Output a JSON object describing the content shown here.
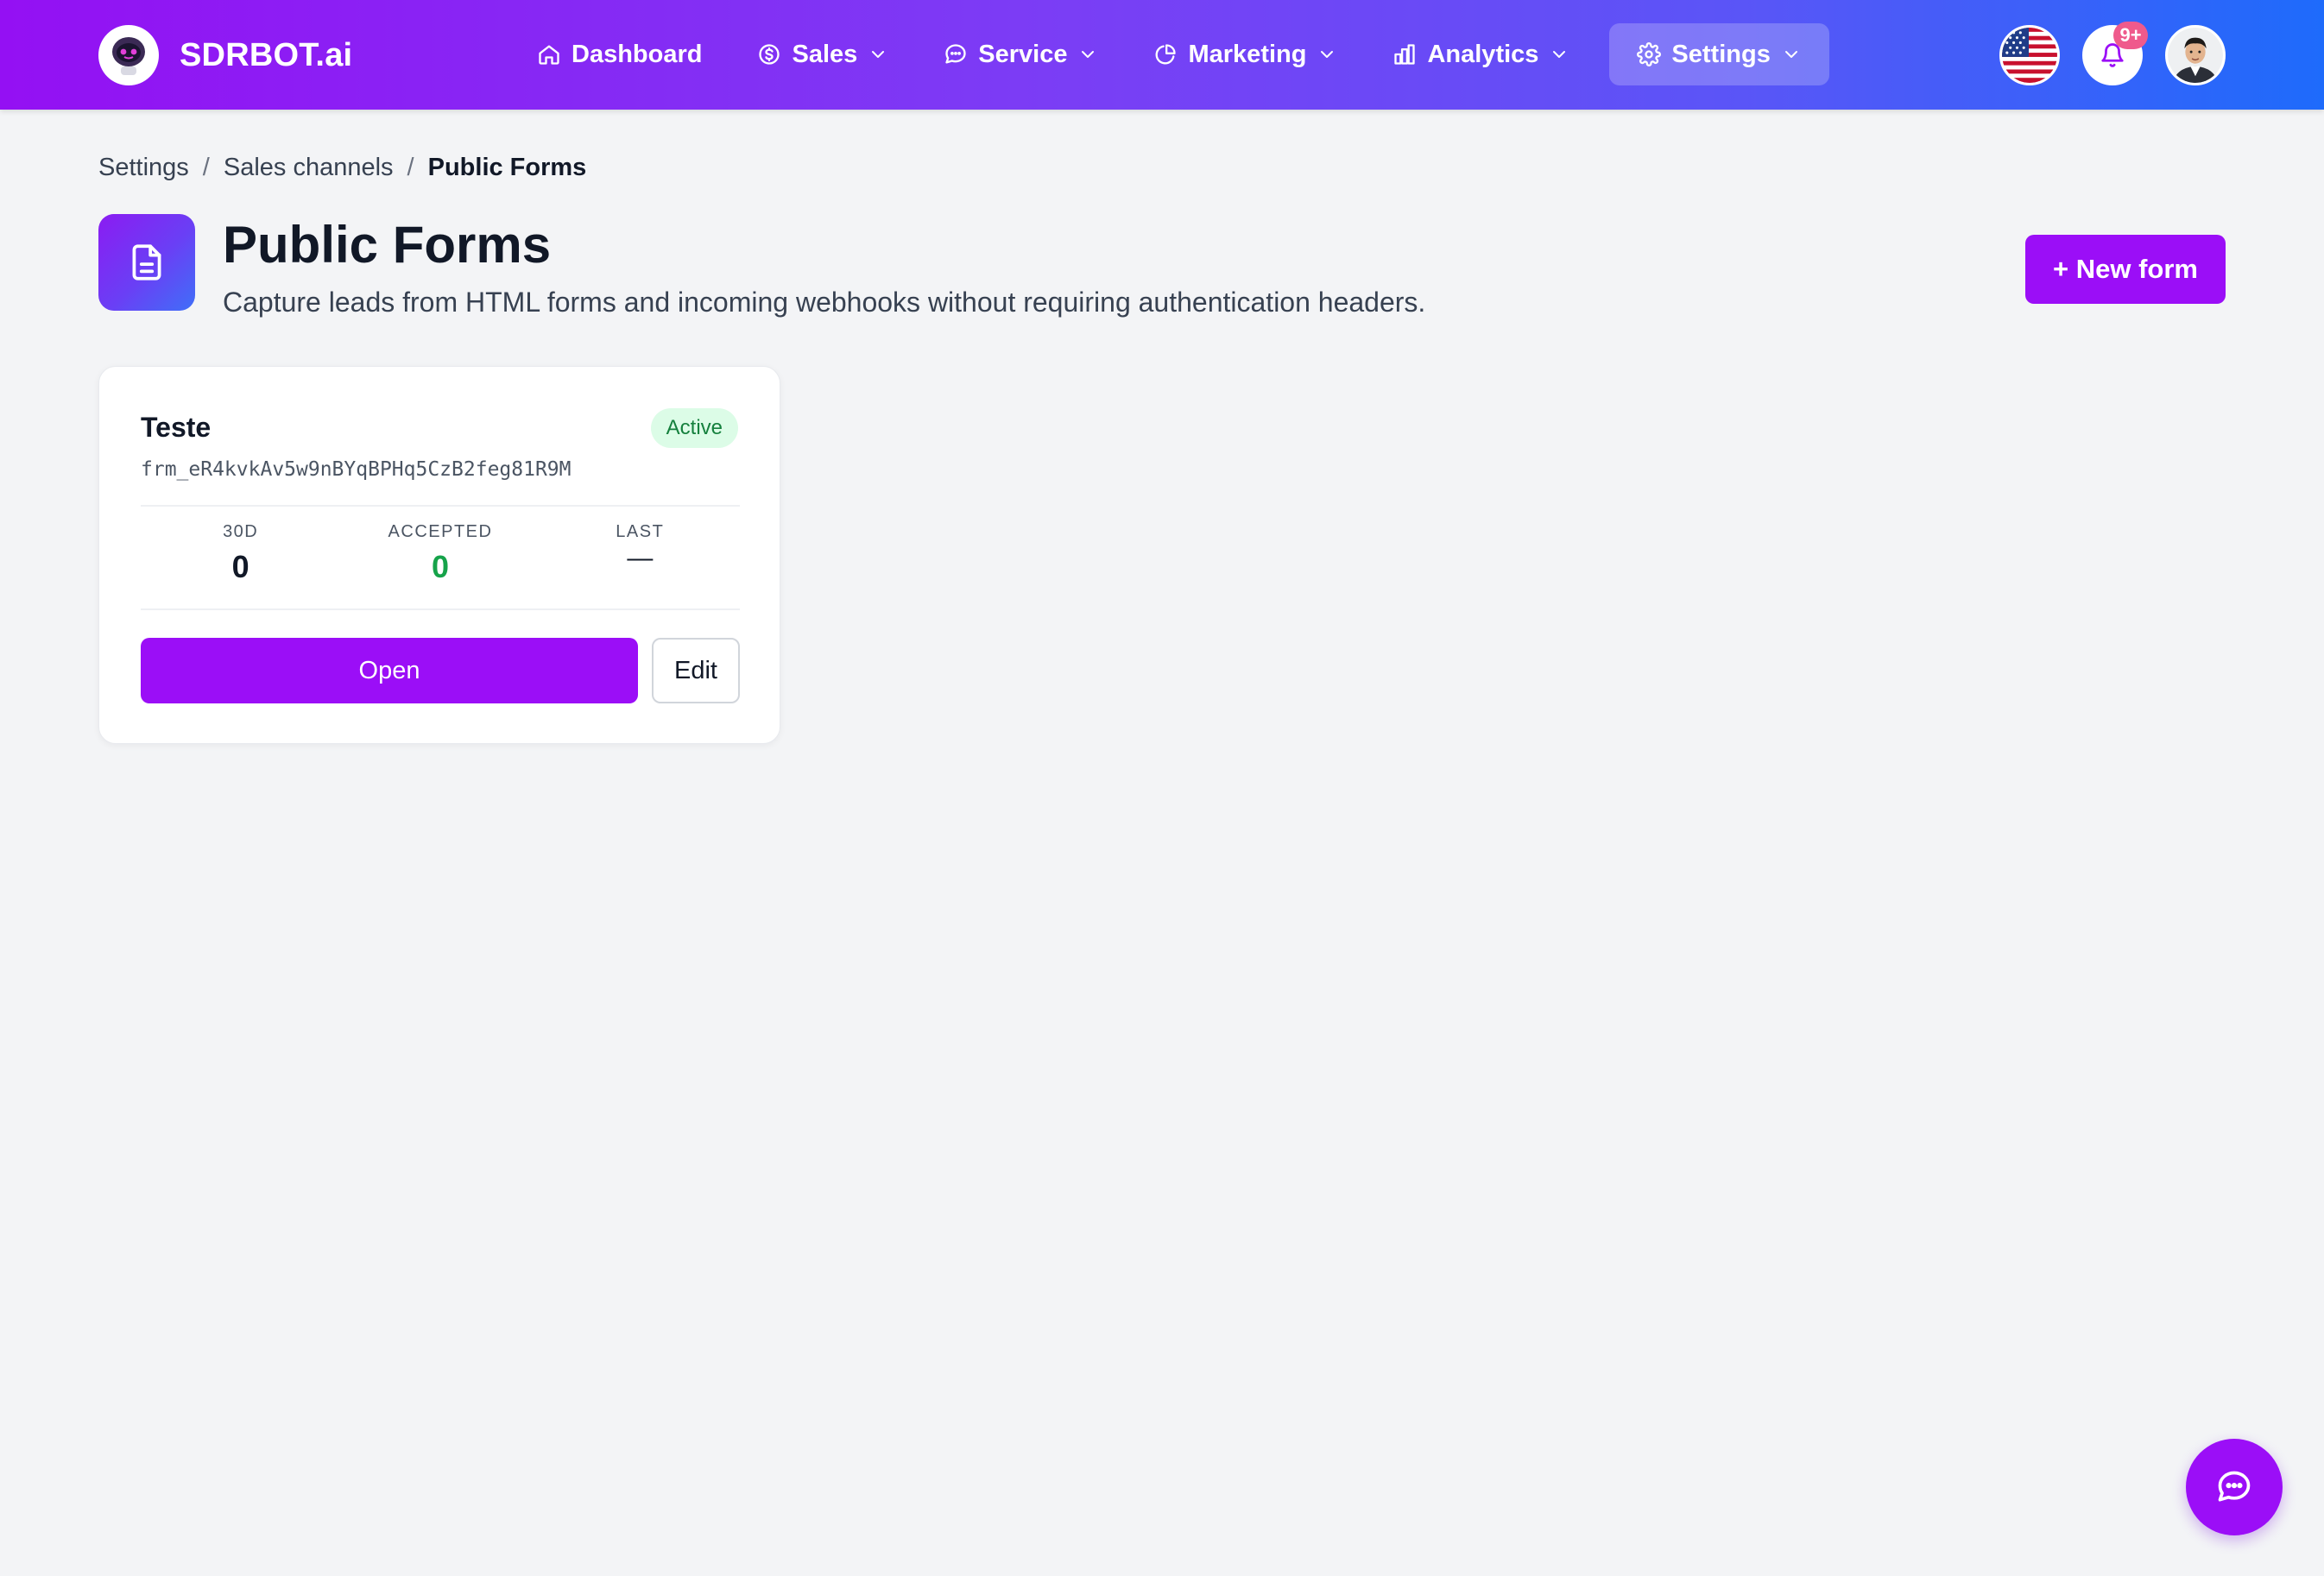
{
  "app": {
    "brand": "SDRBOT.ai"
  },
  "nav": {
    "items": [
      {
        "label": "Dashboard",
        "icon": "home-icon",
        "has_dropdown": false
      },
      {
        "label": "Sales",
        "icon": "dollar-circle-icon",
        "has_dropdown": true
      },
      {
        "label": "Service",
        "icon": "chat-bubble-icon",
        "has_dropdown": true
      },
      {
        "label": "Marketing",
        "icon": "pie-chart-icon",
        "has_dropdown": true
      },
      {
        "label": "Analytics",
        "icon": "bar-chart-icon",
        "has_dropdown": true
      },
      {
        "label": "Settings",
        "icon": "gear-icon",
        "has_dropdown": true,
        "active": true
      }
    ],
    "notification_count": "9+"
  },
  "breadcrumb": {
    "items": [
      "Settings",
      "Sales channels",
      "Public Forms"
    ],
    "separator": "/"
  },
  "header": {
    "title": "Public Forms",
    "subtitle": "Capture leads from HTML forms and incoming webhooks without requiring authentication headers.",
    "new_form_label": "+ New form"
  },
  "forms": [
    {
      "name": "Teste",
      "id": "frm_eR4kvkAv5w9nBYqBPHq5CzB2feg81R9M",
      "status": "Active",
      "stats": [
        {
          "label": "30D",
          "value": "0"
        },
        {
          "label": "ACCEPTED",
          "value": "0"
        },
        {
          "label": "LAST",
          "value": "—"
        }
      ],
      "open_label": "Open",
      "edit_label": "Edit"
    }
  ],
  "colors": {
    "accent": "#9b0ef7",
    "header_gradient_start": "#9410f3",
    "header_gradient_end": "#1e6bfb",
    "active_badge_bg": "#dcfce7",
    "active_badge_text": "#15803d",
    "accepted_value": "#16a34a"
  }
}
